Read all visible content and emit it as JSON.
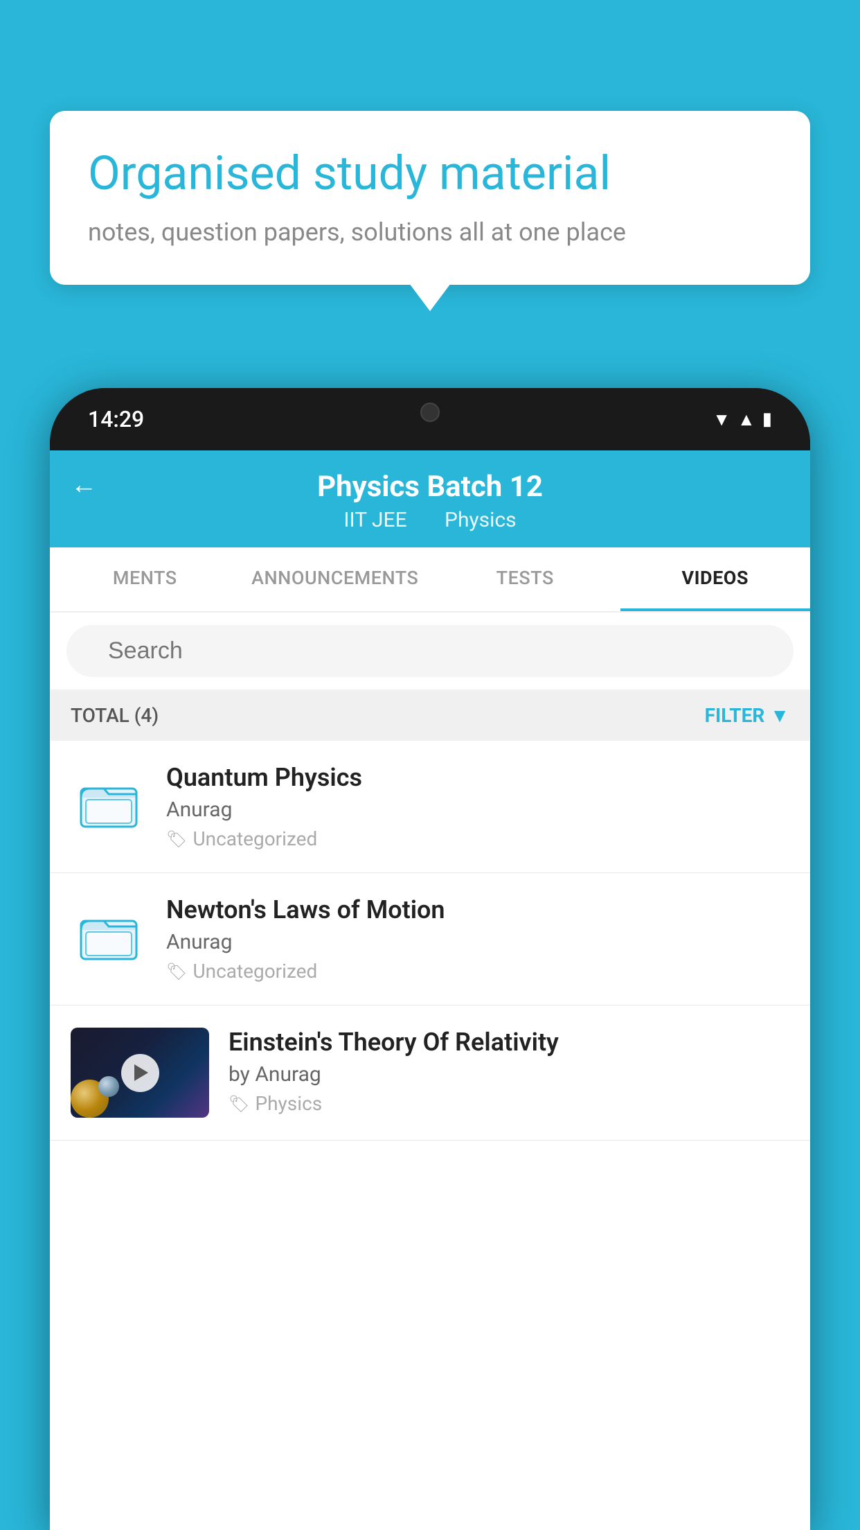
{
  "background_color": "#29b6d8",
  "speech_bubble": {
    "title": "Organised study material",
    "subtitle": "notes, question papers, solutions all at one place"
  },
  "phone": {
    "time": "14:29",
    "status_icons": [
      "wifi",
      "signal",
      "battery"
    ]
  },
  "app": {
    "header": {
      "back_label": "←",
      "title": "Physics Batch 12",
      "subtitle_part1": "IIT JEE",
      "subtitle_part2": "Physics"
    },
    "tabs": [
      {
        "label": "MENTS",
        "active": false
      },
      {
        "label": "ANNOUNCEMENTS",
        "active": false
      },
      {
        "label": "TESTS",
        "active": false
      },
      {
        "label": "VIDEOS",
        "active": true
      }
    ],
    "search": {
      "placeholder": "Search"
    },
    "filter": {
      "total_label": "TOTAL (4)",
      "filter_label": "FILTER"
    },
    "videos": [
      {
        "title": "Quantum Physics",
        "author": "Anurag",
        "tag": "Uncategorized",
        "type": "folder"
      },
      {
        "title": "Newton's Laws of Motion",
        "author": "Anurag",
        "tag": "Uncategorized",
        "type": "folder"
      },
      {
        "title": "Einstein's Theory Of Relativity",
        "author": "by Anurag",
        "tag": "Physics",
        "type": "video"
      }
    ]
  }
}
